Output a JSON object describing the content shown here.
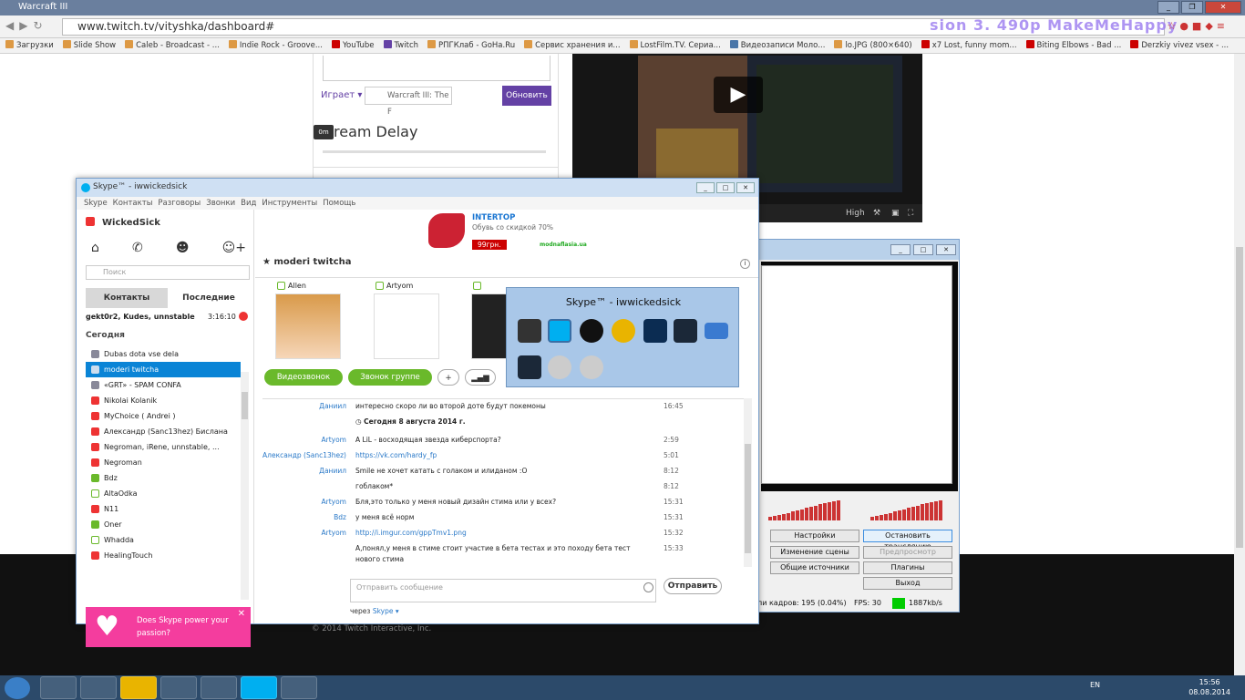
{
  "window": {
    "title": "Warcraft III"
  },
  "browser": {
    "url": "www.twitch.tv/vityshka/dashboard#",
    "overlay_text": "sion    3.    490p MakeMeHappy",
    "bookmarks": [
      "Загрузки",
      "Slide Show",
      "Caleb - Broadcast - ...",
      "Indie Rock - Groove...",
      "YouTube",
      "Twitch",
      "РПГКлаб - GoHa.Ru",
      "Сервис хранения и...",
      "LostFilm.TV. Сериа...",
      "Видеозаписи Моло...",
      "lo.JPG (800×640)",
      "x7 Lost, funny mom...",
      "Biting Elbows - Bad ...",
      "Derzkiy vivez vsex - ..."
    ]
  },
  "twitch": {
    "playing_label": "Играет",
    "game_value": "Warcraft III: The F",
    "update_button": "Обновить",
    "stream_delay": "ream Delay",
    "delay_value": "0m",
    "video_quality": "High",
    "copyright": "© 2014 Twitch Interactive, Inc."
  },
  "skype": {
    "title": "Skype™ - iwwickedsick",
    "menu": [
      "Skype",
      "Контакты",
      "Разговоры",
      "Звонки",
      "Вид",
      "Инструменты",
      "Помощь"
    ],
    "username": "WickedSick",
    "search_placeholder": "Поиск",
    "tab_contacts": "Контакты",
    "tab_recent": "Последние",
    "recent_item": {
      "name": "gekt0r2, Kudes, unnstable",
      "time": "3:16:10"
    },
    "today_label": "Сегодня",
    "contacts": [
      {
        "name": "Dubas dota vse dela",
        "type": "group"
      },
      {
        "name": "moderi twitcha",
        "type": "group"
      },
      {
        "name": "«GRT» - SPAM CONFA",
        "type": "group"
      },
      {
        "name": "Nikolai Kolanik",
        "type": "busy"
      },
      {
        "name": "MyChoice ( Andrei )",
        "type": "busy"
      },
      {
        "name": "Александр (Sanc13hez) Бислана",
        "type": "busy"
      },
      {
        "name": "Negroman, iRene, unnstable, ...",
        "type": "busy"
      },
      {
        "name": "Negroman",
        "type": "busy"
      },
      {
        "name": "Bdz",
        "type": "online"
      },
      {
        "name": "AltaOdka",
        "type": "away"
      },
      {
        "name": "N11",
        "type": "busy"
      },
      {
        "name": "Oner",
        "type": "online"
      },
      {
        "name": "Whadda",
        "type": "away"
      },
      {
        "name": "HealingTouch",
        "type": "busy"
      }
    ],
    "selected_contact": "moderi twitcha",
    "promo": "Does Skype power your passion?",
    "ad": {
      "brand": "INTERTOP",
      "desc": "Обувь со скидкой 70%",
      "price": "99грн.",
      "site": "modnaflasia.ua"
    },
    "chat_title": "moderi twitcha",
    "participants": [
      "Allen",
      "Artyom",
      ""
    ],
    "btn_video": "Видеозвонок",
    "btn_group": "Звонок группе",
    "date_separator": "Сегодня 8 августа 2014 г.",
    "messages": [
      {
        "sender": "Даниил",
        "text": "интересно скоро ли во второй доте будут покемоны",
        "time": "16:45",
        "link": false
      },
      {
        "sender": "Artyom",
        "text": "A LiL - восходящая звезда киберспорта?",
        "time": "2:59",
        "link": false
      },
      {
        "sender": "Александр (Sanc13hez)",
        "text": "https://vk.com/hardy_fp",
        "time": "5:01",
        "link": true
      },
      {
        "sender": "Даниил",
        "text": "Smile не хочет катать с голаком и илиданом :O",
        "time": "8:12",
        "link": false
      },
      {
        "sender": "",
        "text": "гоблаком*",
        "time": "8:12",
        "link": false
      },
      {
        "sender": "Artyom",
        "text": "Бля,это только у меня новый дизайн стима или у всех?",
        "time": "15:31",
        "link": false
      },
      {
        "sender": "Bdz",
        "text": "у меня всё норм",
        "time": "15:31",
        "link": false
      },
      {
        "sender": "Artyom",
        "text": "http://i.imgur.com/gppTmv1.png",
        "time": "15:32",
        "link": true
      },
      {
        "sender": "",
        "text": "А,понял,у меня в стиме стоит участие в бета тестах и это походу бета тест нового стима",
        "time": "15:33",
        "link": false
      }
    ],
    "compose_placeholder": "Отправить сообщение",
    "send_button": "Отправить",
    "via_label": "через",
    "via_link": "Skype ▾",
    "popup_title": "Skype™ - iwwickedsick"
  },
  "obs": {
    "buttons": [
      "Настройки",
      "Остановить трансляцию",
      "Изменение сцены",
      "Предпросмотр",
      "Общие источники",
      "Плагины",
      "Выход"
    ],
    "dropped": "пи кадров: 195 (0.04%)",
    "fps": "FPS: 30",
    "bitrate": "1887kb/s"
  },
  "taskbar": {
    "lang": "EN",
    "time": "15:56",
    "date": "08.08.2014"
  },
  "colors": {
    "twitch_purple": "#6441a5",
    "skype_blue": "#00aff0",
    "selected": "#0a84d6",
    "promo": "#f43d9e"
  }
}
